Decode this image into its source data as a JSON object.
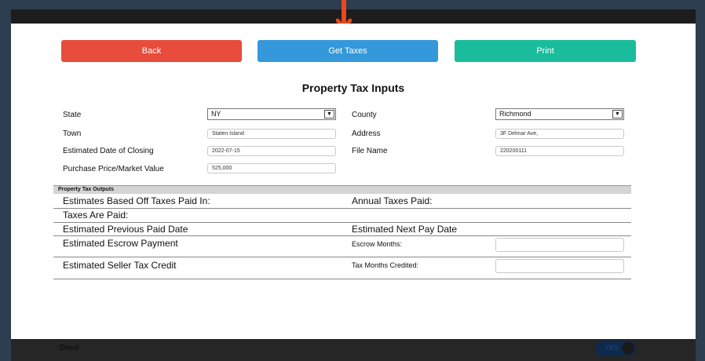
{
  "buttons": {
    "back": "Back",
    "get_taxes": "Get Taxes",
    "print": "Print"
  },
  "title": "Property Tax Inputs",
  "inputs": {
    "state_label": "State",
    "state_value": "NY",
    "county_label": "County",
    "county_value": "Richmond",
    "town_label": "Town",
    "town_value": "Staten Island",
    "address_label": "Address",
    "address_value": "3F Delmar Ave,",
    "closing_label": "Estimated Date of Closing",
    "closing_value": "2022-07-15",
    "filename_label": "File Name",
    "filename_value": "220200111",
    "price_label": "Purchase Price/Market Value",
    "price_value": "525,000"
  },
  "outputs": {
    "section_label": "Property Tax Outputs",
    "based_off": "Estimates Based Off Taxes Paid In:",
    "annual_paid": "Annual Taxes Paid:",
    "taxes_are_paid": "Taxes Are Paid:",
    "prev_paid_date": "Estimated Previous Paid Date",
    "next_pay_date": "Estimated Next Pay Date",
    "escrow_payment": "Estimated Escrow Payment",
    "escrow_months": "Escrow Months:",
    "seller_credit": "Estimated Seller Tax Credit",
    "tax_months_credited": "Tax Months Credited:"
  },
  "bottom": {
    "deed": "Deed",
    "toggle": "YES"
  },
  "colors": {
    "back": "#e74c3c",
    "get_taxes": "#3498db",
    "print": "#1abc9c",
    "arrow": "#e8471f"
  }
}
